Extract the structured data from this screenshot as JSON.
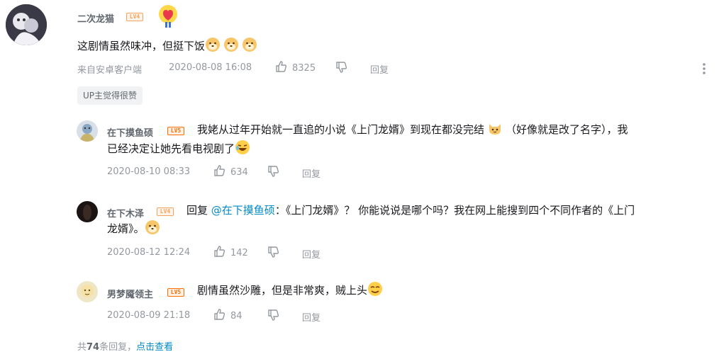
{
  "comment": {
    "username": "二次龙猫",
    "level": "LV4",
    "text": "这剧情虽然味冲，但挺下饭",
    "source": "来自安卓客户端",
    "time": "2020-08-08 16:08",
    "likes": "8325",
    "reply_label": "回复",
    "up_tag": "UP主觉得很赞"
  },
  "replies": [
    {
      "username": "在下摸鱼硕",
      "level": "LV5",
      "text_line1": "我姥从过年开始就一直追的小说《上门龙婿》到现在都没完结",
      "text_line1_b": "（好像就是改了名字），我",
      "text_line2": "已经决定让她先看电视剧了",
      "time": "2020-08-10 08:33",
      "likes": "634",
      "reply_label": "回复"
    },
    {
      "username": "在下木泽",
      "level": "LV4",
      "reply_prefix": "回复",
      "mention": "@在下摸鱼硕",
      "text_line1": "：《上门龙婿》？ 你能说说是哪个吗？我在网上能搜到四个不同作者的《上门",
      "text_line2": "龙婿》。",
      "time": "2020-08-12 12:24",
      "likes": "142",
      "reply_label": "回复"
    },
    {
      "username": "男梦魇领主",
      "level": "LV5",
      "text_line1": "剧情虽然沙雕，但是非常爽，贼上头",
      "time": "2020-08-09 21:18",
      "likes": "84",
      "reply_label": "回复"
    }
  ],
  "footer": {
    "prefix": "共",
    "count": "74",
    "suffix": "条回复，",
    "view_link": "点击查看"
  },
  "colors": {
    "link": "#008ac5",
    "level4": "#f5a45d",
    "level5": "#ff6c00",
    "meta": "#9499a0"
  }
}
